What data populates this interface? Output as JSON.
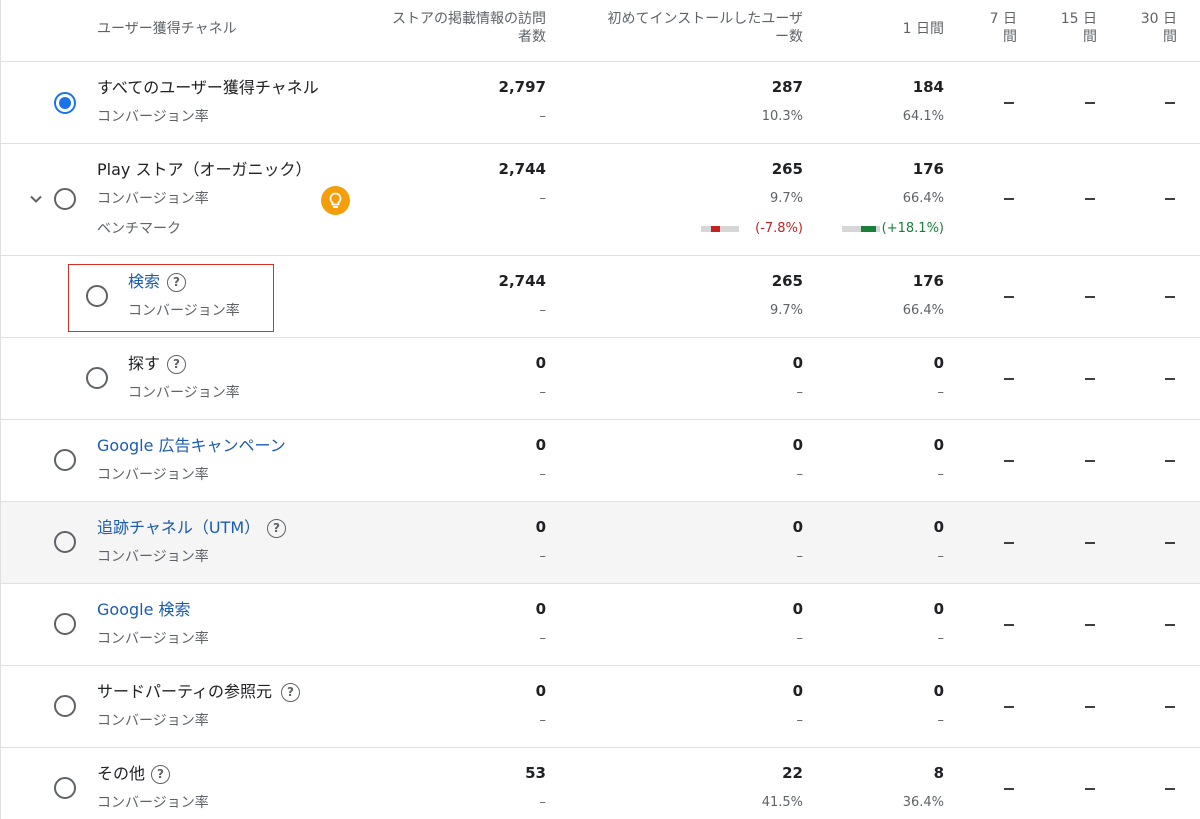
{
  "header": {
    "channel": "ユーザー獲得チャネル",
    "store_visitors": [
      "ストアの掲載情報の訪問",
      "者数"
    ],
    "first_installers": [
      "初めてインストールしたユーザ",
      "ー数"
    ],
    "day1": "1 日間",
    "day7": [
      "7 日",
      "間"
    ],
    "day15": [
      "15 日",
      "間"
    ],
    "day30": [
      "30 日",
      "間"
    ]
  },
  "dash_symbol": "–",
  "rows": [
    {
      "name": "すべてのユーザー獲得チャネル",
      "sub": "コンバージョン率",
      "visitors": "2,797",
      "visitors_rate": "–",
      "installers": "287",
      "installers_rate": "10.3%",
      "day1": "184",
      "day1_rate": "64.1%",
      "selected": true
    },
    {
      "name": "Play ストア（オーガニック）",
      "sub": "コンバージョン率",
      "benchmark_label": "ベンチマーク",
      "visitors": "2,744",
      "visitors_rate": "–",
      "installers": "265",
      "installers_rate": "9.7%",
      "installers_bench": "(-7.8%)",
      "installers_bench_change": -7.8,
      "day1": "176",
      "day1_rate": "66.4%",
      "day1_bench": "(+18.1%)",
      "day1_bench_change": 18.1,
      "expanded": true
    },
    {
      "name": "検索",
      "sub": "コンバージョン率",
      "visitors": "2,744",
      "visitors_rate": "–",
      "installers": "265",
      "installers_rate": "9.7%",
      "day1": "176",
      "day1_rate": "66.4%"
    },
    {
      "name": "探す",
      "sub": "コンバージョン率",
      "visitors": "0",
      "visitors_rate": "–",
      "installers": "0",
      "installers_rate": "–",
      "day1": "0",
      "day1_rate": "–"
    },
    {
      "name": "Google 広告キャンペーン",
      "sub": "コンバージョン率",
      "visitors": "0",
      "visitors_rate": "–",
      "installers": "0",
      "installers_rate": "–",
      "day1": "0",
      "day1_rate": "–"
    },
    {
      "name": "追跡チャネル（UTM）",
      "sub": "コンバージョン率",
      "visitors": "0",
      "visitors_rate": "–",
      "installers": "0",
      "installers_rate": "–",
      "day1": "0",
      "day1_rate": "–"
    },
    {
      "name": "Google 検索",
      "sub": "コンバージョン率",
      "visitors": "0",
      "visitors_rate": "–",
      "installers": "0",
      "installers_rate": "–",
      "day1": "0",
      "day1_rate": "–"
    },
    {
      "name": "サードパーティの参照元",
      "sub": "コンバージョン率",
      "visitors": "0",
      "visitors_rate": "–",
      "installers": "0",
      "installers_rate": "–",
      "day1": "0",
      "day1_rate": "–"
    },
    {
      "name": "その他",
      "sub": "コンバージョン率",
      "visitors": "53",
      "visitors_rate": "–",
      "installers": "22",
      "installers_rate": "41.5%",
      "day1": "8",
      "day1_rate": "36.4%"
    }
  ],
  "icons": {
    "radio": "radio-button",
    "expand": "chevron-down-icon",
    "help": "help-circle-icon",
    "insight": "lightbulb-icon"
  },
  "help_glyph": "?",
  "colors": {
    "link": "#1a5bb3",
    "selected": "#1a73e8",
    "negative": "#c5221f",
    "positive": "#188038",
    "bulb": "#f59e0b",
    "highlight": "#d93025",
    "shaded_row": "#f5f5f5"
  }
}
